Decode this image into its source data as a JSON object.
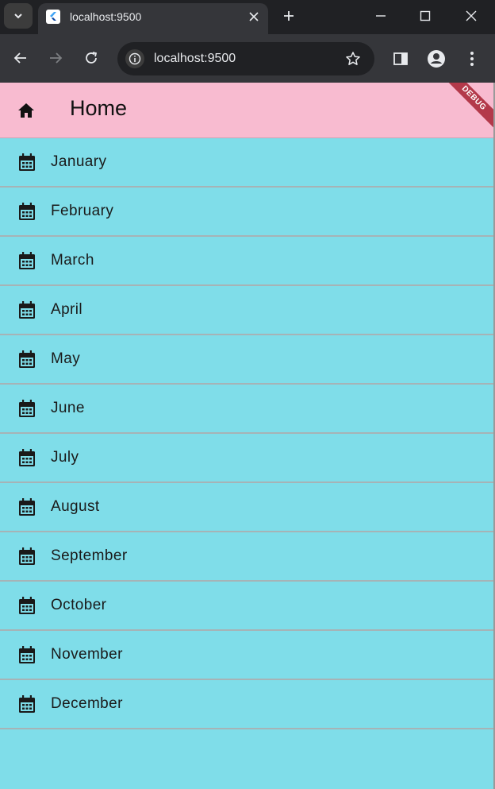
{
  "browser": {
    "tab_title": "localhost:9500",
    "url": "localhost:9500"
  },
  "app": {
    "title": "Home",
    "debug_label": "DEBUG"
  },
  "months": [
    {
      "label": "January"
    },
    {
      "label": "February"
    },
    {
      "label": "March"
    },
    {
      "label": "April"
    },
    {
      "label": "May"
    },
    {
      "label": "June"
    },
    {
      "label": "July"
    },
    {
      "label": "August"
    },
    {
      "label": "September"
    },
    {
      "label": "October"
    },
    {
      "label": "November"
    },
    {
      "label": "December"
    }
  ],
  "colors": {
    "appbar": "#f8bbd0",
    "list_bg": "#7fdde9",
    "ribbon": "#b3394a"
  }
}
